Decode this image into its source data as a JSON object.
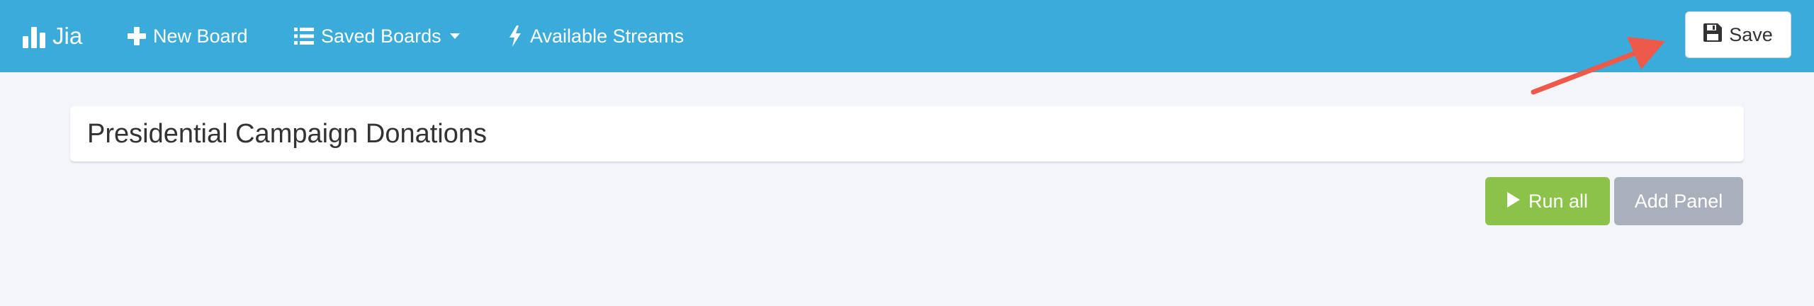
{
  "navbar": {
    "brand_label": "Jia",
    "brand_icon": "bar-chart-icon",
    "new_board_label": "New Board",
    "new_board_icon": "plus-icon",
    "saved_boards_label": "Saved Boards",
    "saved_boards_icon": "list-icon",
    "streams_label": "Available Streams",
    "streams_icon": "bolt-icon",
    "save_label": "Save",
    "save_icon": "floppy-disk-icon",
    "background_color": "#3bacda"
  },
  "board": {
    "title_value": "Presidential Campaign Donations"
  },
  "actions": {
    "run_all_label": "Run all",
    "run_all_icon": "play-icon",
    "run_all_color": "#8bc34a",
    "add_panel_label": "Add Panel",
    "add_panel_color": "#a9b0bb"
  },
  "annotation": {
    "arrow_color": "#ee5a4a",
    "arrow_target": "save-button"
  }
}
